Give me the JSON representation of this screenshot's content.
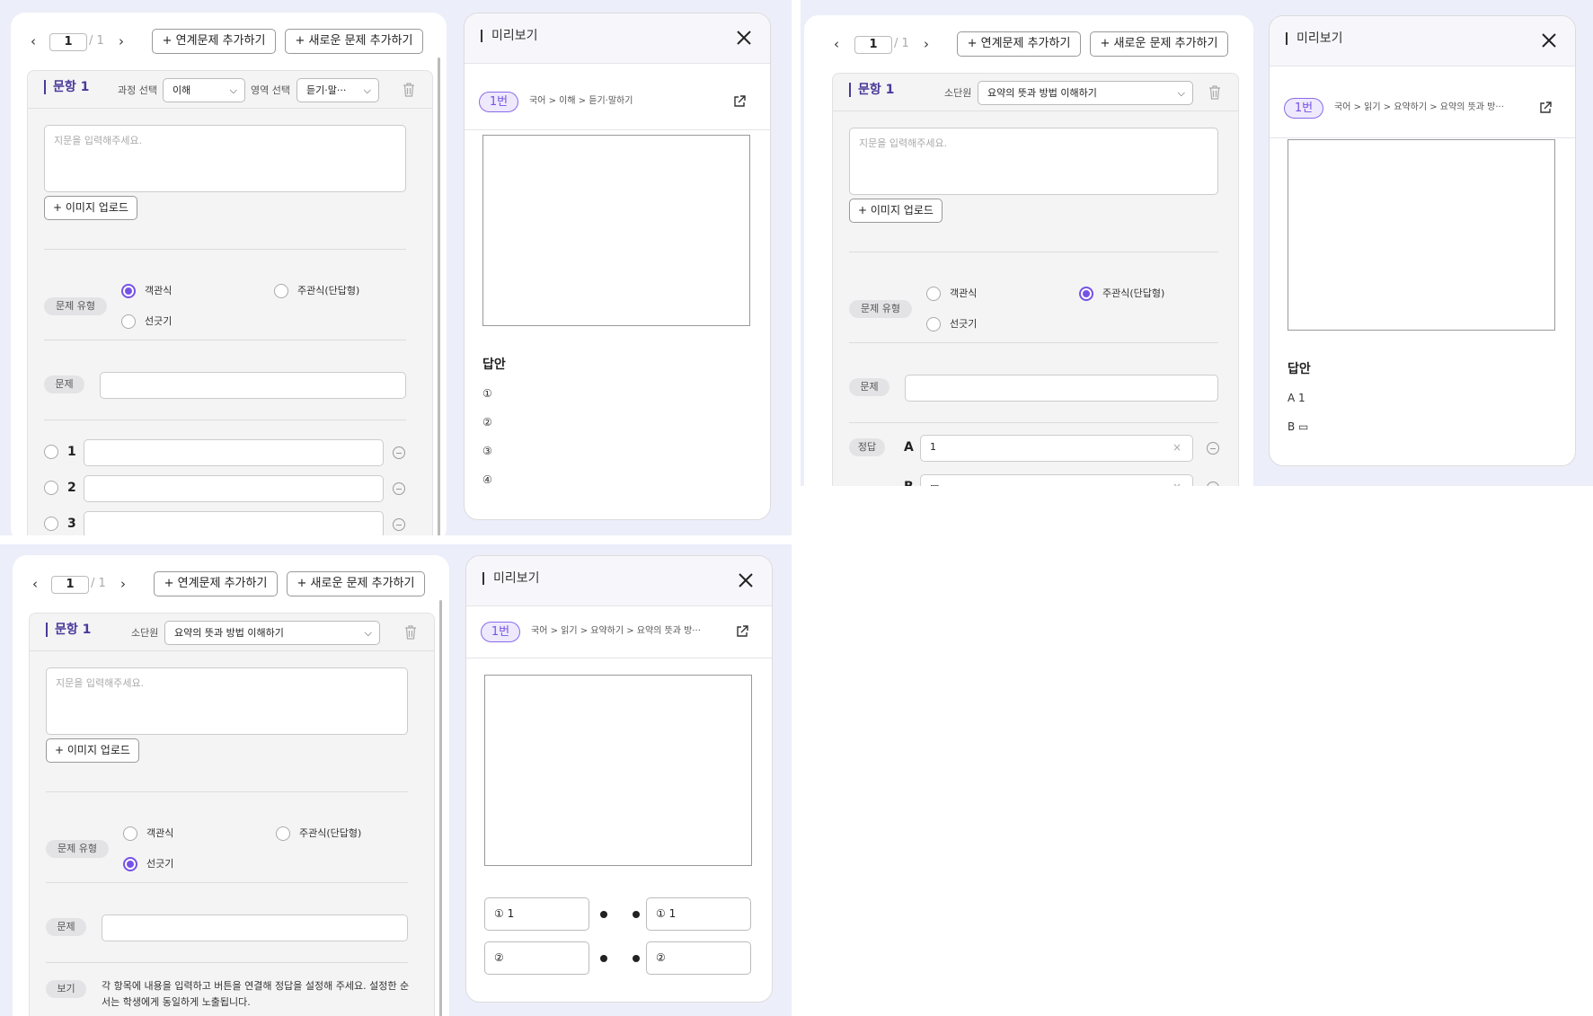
{
  "common": {
    "prev": "‹",
    "next": "›",
    "page_current": "1",
    "page_total": "/ 1",
    "btn_linked": "+ 연계문제 추가하기",
    "btn_new": "+ 새로운 문제 추가하기",
    "question_title": "문항 1",
    "passage_placeholder": "지문을 입력해주세요.",
    "upload_label": "+ 이미지 업로드",
    "type_label": "문제 유형",
    "opt_objective": "객관식",
    "opt_subjective": "주관식(단답형)",
    "opt_line": "선긋기",
    "question_label": "문제",
    "preview_title": "미리보기",
    "badge": "1번",
    "answer_heading": "답안"
  },
  "panel1": {
    "course_label": "과정 선택",
    "course_value": "이해",
    "area_label": "영역 선택",
    "area_value": "듣기·말···",
    "selected_type": "objective",
    "options": [
      "1",
      "2",
      "3"
    ],
    "breadcrumb": "국어 > 이해 > 듣기·말하기",
    "answers": [
      "①",
      "②",
      "③",
      "④"
    ]
  },
  "panel2": {
    "unit_label": "소단원",
    "unit_value": "요약의 뜻과 방법 이해하기",
    "selected_type": "subjective",
    "answer_label": "정답",
    "answer_rows": [
      {
        "key": "A",
        "value": "1"
      },
      {
        "key": "B",
        "value": "▭"
      }
    ],
    "clear_icon": "×",
    "breadcrumb": "국어 > 읽기 > 요약하기 > 요약의 뜻과 방···",
    "answers": [
      "A 1",
      "B ▭"
    ]
  },
  "panel3": {
    "unit_label": "소단원",
    "unit_value": "요약의 뜻과 방법 이해하기",
    "selected_type": "line",
    "example_label": "보기",
    "example_text": "각 항목에 내용을 입력하고 버튼을 연결해 정답을 설정해 주세요. 설정한 순서는 학생에게 동일하게 노출됩니다.",
    "breadcrumb": "국어 > 읽기 > 요약하기 > 요약의 뜻과 방···",
    "matching": [
      {
        "left": "① 1",
        "right": "① 1"
      },
      {
        "left": "②",
        "right": "②"
      }
    ]
  },
  "colors": {
    "accent": "#7553e6",
    "title": "#4a3a9a",
    "background": "#eceef9"
  }
}
